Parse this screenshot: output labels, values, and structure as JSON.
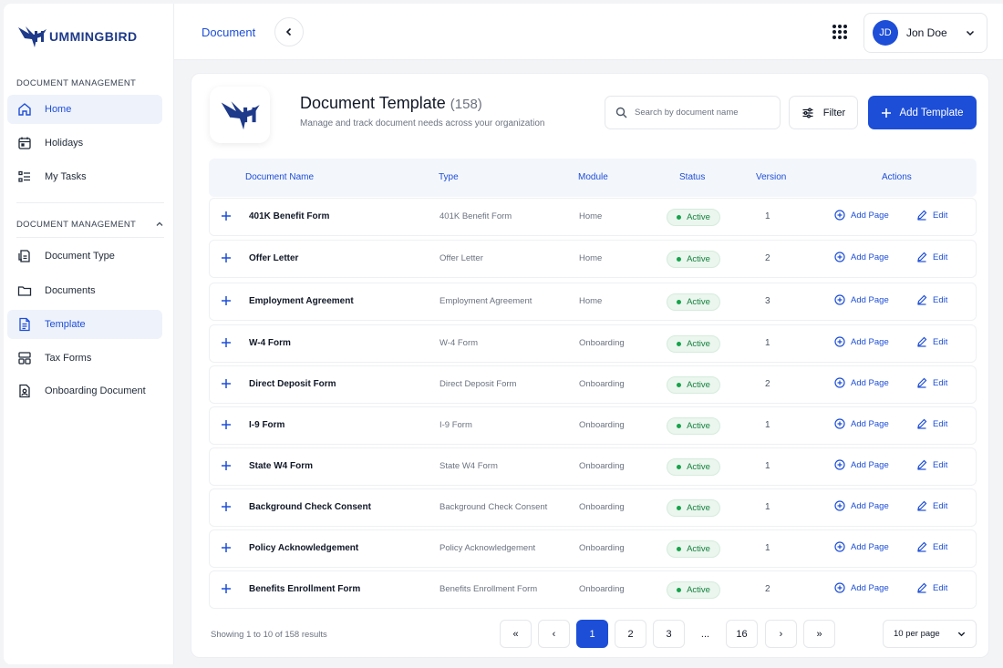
{
  "brand": {
    "name": "UMMINGBIRD"
  },
  "sidebar": {
    "section1_label": "DOCUMENT MANAGEMENT",
    "section2_label": "DOCUMENT MANAGEMENT",
    "items_top": [
      {
        "label": "Home",
        "icon": "home-icon",
        "active": true
      },
      {
        "label": "Holidays",
        "icon": "calendar-icon",
        "active": false
      },
      {
        "label": "My Tasks",
        "icon": "tasks-icon",
        "active": false
      }
    ],
    "items_docs": [
      {
        "label": "Document Type",
        "icon": "document-type-icon",
        "active": false
      },
      {
        "label": "Documents",
        "icon": "folder-icon",
        "active": false
      },
      {
        "label": "Template",
        "icon": "template-icon",
        "active": true
      },
      {
        "label": "Tax Forms",
        "icon": "tax-forms-icon",
        "active": false
      },
      {
        "label": "Onboarding Document",
        "icon": "onboarding-icon",
        "active": false
      }
    ]
  },
  "topbar": {
    "breadcrumb": "Document",
    "user_initials": "JD",
    "user_name": "Jon Doe"
  },
  "page": {
    "title": "Document Template",
    "count": "(158)",
    "subtitle": "Manage and track document needs across your organization",
    "search_placeholder": "Search by document name",
    "filter_label": "Filter",
    "add_label": "Add Template"
  },
  "table": {
    "headers": {
      "name": "Document Name",
      "type": "Type",
      "module": "Module",
      "status": "Status",
      "version": "Version",
      "actions": "Actions"
    },
    "action_add_page": "Add Page",
    "action_edit": "Edit",
    "rows": [
      {
        "name": "401K Benefit Form",
        "type": "401K Benefit Form",
        "module": "Home",
        "status": "Active",
        "version": "1"
      },
      {
        "name": "Offer Letter",
        "type": "Offer Letter",
        "module": "Home",
        "status": "Active",
        "version": "2"
      },
      {
        "name": "Employment Agreement",
        "type": "Employment Agreement",
        "module": "Home",
        "status": "Active",
        "version": "3"
      },
      {
        "name": "W-4 Form",
        "type": "W-4 Form",
        "module": "Onboarding",
        "status": "Active",
        "version": "1"
      },
      {
        "name": "Direct Deposit Form",
        "type": "Direct Deposit Form",
        "module": "Onboarding",
        "status": "Active",
        "version": "2"
      },
      {
        "name": "I-9 Form",
        "type": "I-9 Form",
        "module": "Onboarding",
        "status": "Active",
        "version": "1"
      },
      {
        "name": "State W4 Form",
        "type": "State W4 Form",
        "module": "Onboarding",
        "status": "Active",
        "version": "1"
      },
      {
        "name": "Background Check Consent",
        "type": "Background Check Consent",
        "module": "Onboarding",
        "status": "Active",
        "version": "1"
      },
      {
        "name": "Policy Acknowledgement",
        "type": "Policy Acknowledgement",
        "module": "Onboarding",
        "status": "Active",
        "version": "1"
      },
      {
        "name": "Benefits Enrollment Form",
        "type": "Benefits Enrollment Form",
        "module": "Onboarding",
        "status": "Active",
        "version": "2"
      }
    ]
  },
  "pagination": {
    "info": "Showing 1 to 10 of 158 results",
    "first": "«",
    "prev": "‹",
    "pages": [
      "1",
      "2",
      "3",
      "...",
      "16"
    ],
    "current": "1",
    "next": "›",
    "last": "»",
    "per_page": "10 per page"
  },
  "colors": {
    "primary": "#1d4ed8",
    "active_bg": "#eef2fb",
    "status_green": "#16a34a"
  }
}
